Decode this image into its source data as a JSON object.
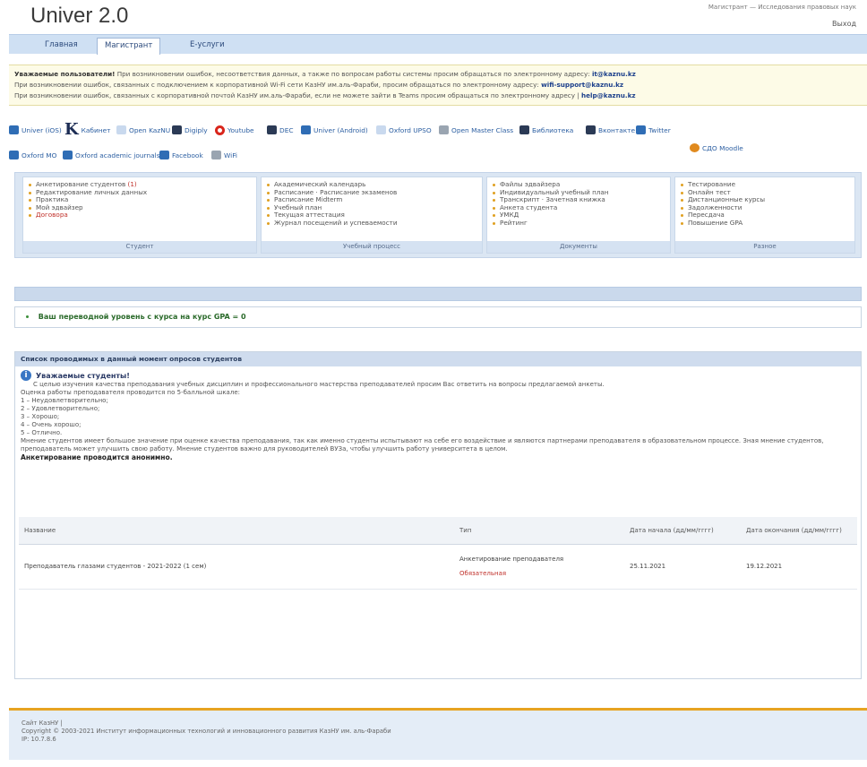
{
  "header": {
    "logo": "Univer 2.0",
    "top_info": "Магистрант — Исследования правовых наук",
    "logout": "Выход"
  },
  "nav": {
    "tabs": [
      {
        "label": "Главная"
      },
      {
        "label": "Магистрант"
      },
      {
        "label": "Е-услуги"
      }
    ]
  },
  "notice": {
    "line1_bold": "Уважаемые пользователи!",
    "line1": "При возникновении ошибок, несоответствия данных, а также по вопросам работы системы просим обращаться по электронному адресу:",
    "line1_email": "it@kaznu.kz",
    "line2": "При возникновении ошибок, связанных с подключением к корпоративной Wi-Fi сети КазНУ им.аль-Фараби, просим обращаться по электронному адресу:",
    "line2_email": "wifi-support@kaznu.kz",
    "line3": "При возникновении ошибок, связанных с корпоративной почтой КазНУ им.аль-Фараби, если не можете зайти в Teams просим обращаться по электронному адресу |",
    "line3_email": "help@kaznu.kz"
  },
  "links": [
    {
      "label": "Univer (iOS)",
      "icon": "app-icon"
    },
    {
      "label": "Кабинет",
      "icon": "k-icon"
    },
    {
      "label": "Open KazNU",
      "icon": "mail-icon"
    },
    {
      "label": "Digiply",
      "icon": "book-icon"
    },
    {
      "label": "Youtube",
      "icon": "youtube-icon"
    },
    {
      "label": "DEC",
      "icon": "dec-icon"
    },
    {
      "label": "Univer (Android)",
      "icon": "app-icon"
    },
    {
      "label": "Oxford UPSO",
      "icon": "oxford-icon"
    },
    {
      "label": "Open Master Class",
      "icon": "class-icon"
    },
    {
      "label": "Библиотека",
      "icon": "library-icon"
    },
    {
      "label": "Вконтакте",
      "icon": "vk-icon"
    },
    {
      "label": "Twitter",
      "icon": "twitter-icon"
    },
    {
      "label": "Oxford MO",
      "icon": "oxford-icon"
    },
    {
      "label": "Oxford academic journals",
      "icon": "journal-icon"
    },
    {
      "label": "Facebook",
      "icon": "facebook-icon"
    },
    {
      "label": "WiFi",
      "icon": "wifi-icon"
    },
    {
      "label": "СДО Moodle",
      "icon": "moodle-icon"
    }
  ],
  "menus": [
    {
      "footer": "Студент",
      "items": [
        {
          "label": "Анкетирование студентов",
          "count": "(1)"
        },
        {
          "label": "Редактирование личных данных"
        },
        {
          "label": "Практика"
        },
        {
          "label": "Мой эдвайзер"
        },
        {
          "label": "Договора"
        }
      ]
    },
    {
      "footer": "Учебный процесс",
      "items": [
        {
          "label": "Академический календарь"
        },
        {
          "label": "Расписание · Расписание экзаменов"
        },
        {
          "label": "Расписание Midterm"
        },
        {
          "label": "Учебный план"
        },
        {
          "label": "Текущая аттестация"
        },
        {
          "label": "Журнал посещений и успеваемости"
        }
      ]
    },
    {
      "footer": "Документы",
      "items": [
        {
          "label": "Файлы эдвайзера"
        },
        {
          "label": "Индивидуальный учебный план"
        },
        {
          "label": "Транскрипт · Зачетная книжка"
        },
        {
          "label": "Анкета студента"
        },
        {
          "label": "УМКД"
        },
        {
          "label": "Рейтинг"
        }
      ]
    },
    {
      "footer": "Разное",
      "items": [
        {
          "label": "Тестирование"
        },
        {
          "label": "Онлайн тест"
        },
        {
          "label": "Дистанционные курсы"
        },
        {
          "label": "Задолженности"
        },
        {
          "label": "Пересдача"
        },
        {
          "label": "Повышение GPA"
        }
      ]
    }
  ],
  "gpa": {
    "text": "Ваш переводной уровень с курса на курс GPA = 0"
  },
  "survey": {
    "title": "Список проводимых в данный момент опросов студентов",
    "greeting": "Уважаемые студенты!",
    "intro": "С целью изучения качества преподавания учебных дисциплин и профессионального мастерства преподавателей просим Вас ответить на вопросы предлагаемой анкеты.",
    "scale_intro": "Оценка работы преподавателя проводится по 5-балльной шкале:",
    "scale": [
      "1 – Неудовлетворительно;",
      "2 – Удовлетворительно;",
      "3 – Хорошо;",
      "4 – Очень хорошо;",
      "5 – Отлично."
    ],
    "paragraph": "Мнение студентов имеет большое значение при оценке качества преподавания, так как именно студенты испытывают на себе его воздействие и являются партнерами преподавателя в образовательном процессе. Зная мнение студентов, преподаватель может улучшить свою работу. Мнение студентов важно для руководителей ВУЗа, чтобы улучшить работу университета в целом.",
    "anonymous": "Анкетирование проводится анонимно.",
    "table": {
      "headers": [
        "Название",
        "Тип",
        "Дата начала (дд/мм/гггг)",
        "Дата окончания (дд/мм/гггг)"
      ],
      "rows": [
        {
          "name": "Преподаватель глазами студентов - 2021-2022 (1 сем)",
          "type": "Анкетирование преподавателя",
          "required": "Обязательная",
          "start": "25.11.2021",
          "end": "19.12.2021"
        }
      ]
    }
  },
  "footer": {
    "line1": "Сайт КазНУ |",
    "line2": "Copyright © 2003-2021 Институт информационных технологий и инновационного развития КазНУ им. аль-Фараби",
    "line3": "IP: 10.7.8.6"
  }
}
